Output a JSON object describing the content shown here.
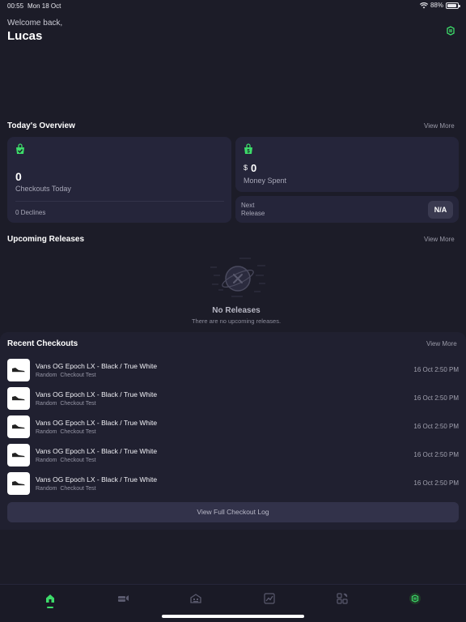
{
  "status_bar": {
    "time": "00:55",
    "date": "Mon 18 Oct",
    "battery": "88%",
    "battery_level": 0.88
  },
  "header": {
    "greeting": "Welcome back,",
    "username": "Lucas"
  },
  "overview": {
    "title": "Today's Overview",
    "view_more": "View More",
    "checkouts": {
      "value": "0",
      "label": "Checkouts Today",
      "declines": "0 Declines"
    },
    "money": {
      "currency": "$",
      "value": "0",
      "label": "Money Spent"
    },
    "next_release": {
      "label_line1": "Next",
      "label_line2": "Release",
      "value": "N/A"
    }
  },
  "upcoming": {
    "title": "Upcoming Releases",
    "view_more": "View More",
    "empty_title": "No Releases",
    "empty_subtitle": "There are no upcoming releases."
  },
  "recent": {
    "title": "Recent Checkouts",
    "view_more": "View More",
    "items": [
      {
        "name": "Vans OG Epoch LX - Black / True White",
        "subtitle": "Random  Checkout Test",
        "time": "16 Oct 2:50 PM"
      },
      {
        "name": "Vans OG Epoch LX - Black / True White",
        "subtitle": "Random  Checkout Test",
        "time": "16 Oct 2:50 PM"
      },
      {
        "name": "Vans OG Epoch LX - Black / True White",
        "subtitle": "Random  Checkout Test",
        "time": "16 Oct 2:50 PM"
      },
      {
        "name": "Vans OG Epoch LX - Black / True White",
        "subtitle": "Random  Checkout Test",
        "time": "16 Oct 2:50 PM"
      },
      {
        "name": "Vans OG Epoch LX - Black / True White",
        "subtitle": "Random  Checkout Test",
        "time": "16 Oct 2:50 PM"
      }
    ],
    "log_button": "View Full Checkout Log"
  },
  "tabs": [
    {
      "icon": "home-icon",
      "active": true
    },
    {
      "icon": "tasks-icon",
      "active": false
    },
    {
      "icon": "store-icon",
      "active": false
    },
    {
      "icon": "analytics-icon",
      "active": false
    },
    {
      "icon": "tools-icon",
      "active": false
    },
    {
      "icon": "brand-icon",
      "active": false
    }
  ],
  "colors": {
    "accent": "#3ddc6a",
    "background": "#1c1c28",
    "card": "#25253a"
  }
}
